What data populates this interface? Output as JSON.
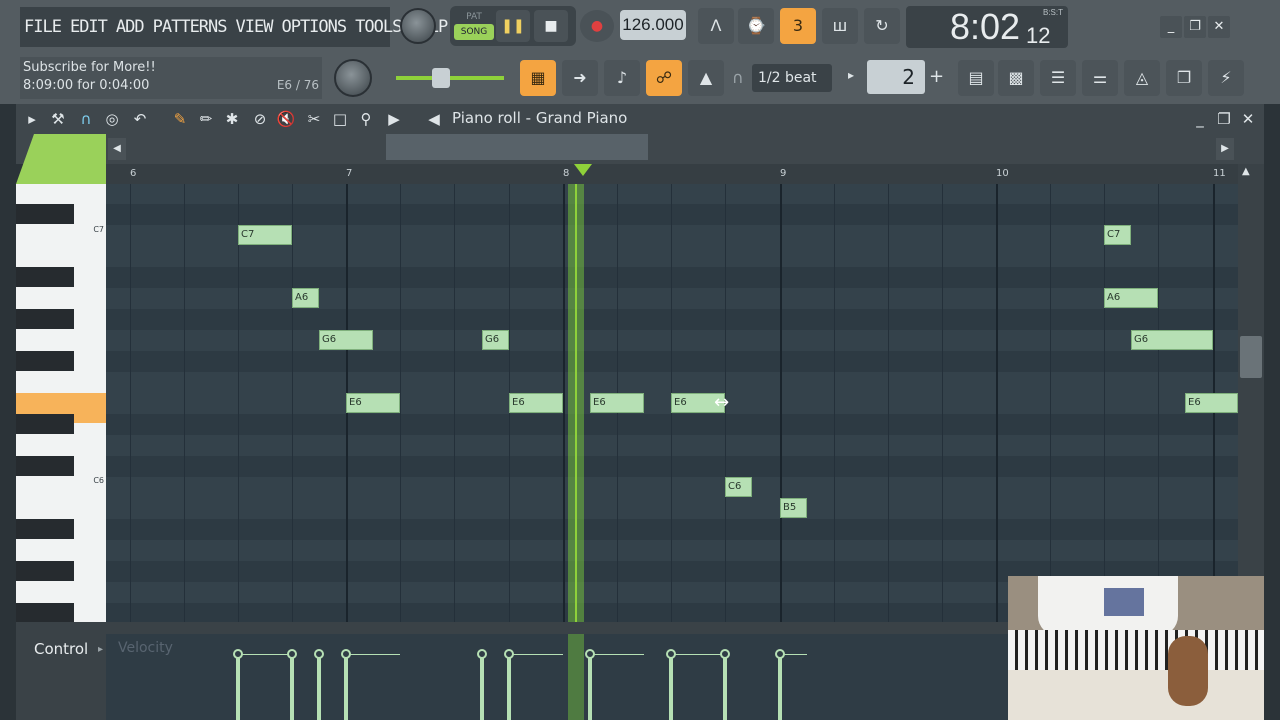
{
  "menu": [
    "FILE",
    "EDIT",
    "ADD",
    "PATTERNS",
    "VIEW",
    "OPTIONS",
    "TOOLS",
    "HELP"
  ],
  "hint": {
    "line1": "Subscribe for More!!",
    "line2": "8:09:00 for 0:04:00",
    "note": "E6 / 76"
  },
  "transport": {
    "pat": "PAT",
    "song": "SONG",
    "tempo": "126.000"
  },
  "clock": {
    "time": "8:02",
    "sub": "12",
    "label": "B:S:T"
  },
  "snap": "1/2 beat",
  "stepper": "2",
  "pianoroll": {
    "title": "Piano roll - Grand Piano"
  },
  "ruler": [
    "6",
    "7",
    "8",
    "9",
    "10",
    "11"
  ],
  "keys": {
    "c7": "C7",
    "c6": "C6"
  },
  "notes": [
    {
      "label": "C7"
    },
    {
      "label": "A6"
    },
    {
      "label": "G6"
    },
    {
      "label": "E6"
    },
    {
      "label": "G6"
    },
    {
      "label": "E6"
    },
    {
      "label": "E6"
    },
    {
      "label": "E6"
    },
    {
      "label": "C6"
    },
    {
      "label": "B5"
    },
    {
      "label": "C7"
    },
    {
      "label": "A6"
    },
    {
      "label": "G6"
    },
    {
      "label": "E6"
    }
  ],
  "control": {
    "label": "Control",
    "target": "Velocity"
  },
  "colors": {
    "accent": "#f4a441",
    "note": "#b6e0b4",
    "playhead": "#8fd13a",
    "song": "#9ad15a"
  }
}
